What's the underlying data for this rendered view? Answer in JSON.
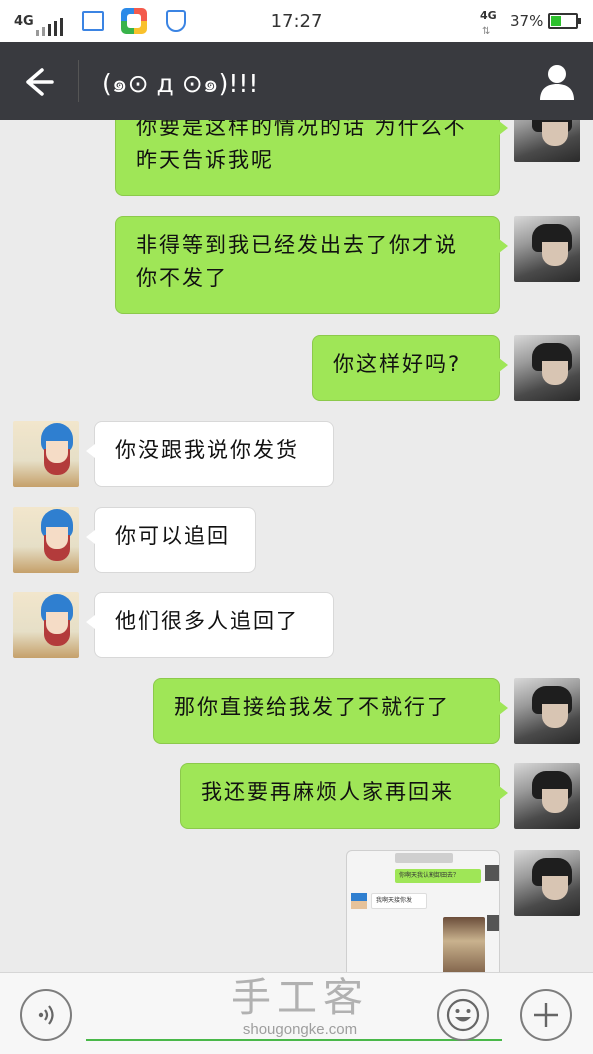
{
  "status_bar": {
    "network_left": "4G",
    "time": "17:27",
    "network_right": "4G",
    "battery_text": "37%",
    "battery_level": 0.37,
    "icons": [
      "signal-icon",
      "gallery-icon",
      "app-store-icon",
      "shield-icon",
      "data-arrows-icon",
      "battery-icon"
    ]
  },
  "header": {
    "title": "(๑⊙ д ⊙๑)!!!",
    "back_icon": "back-arrow-icon",
    "profile_icon": "person-icon"
  },
  "messages": [
    {
      "sender": "me",
      "text": "你要是这样的情况的话 为什么不昨天告诉我呢"
    },
    {
      "sender": "me",
      "text": "非得等到我已经发出去了你才说你不发了"
    },
    {
      "sender": "me",
      "text": "你这样好吗?"
    },
    {
      "sender": "other",
      "text": "你没跟我说你发货"
    },
    {
      "sender": "other",
      "text": "你可以追回"
    },
    {
      "sender": "other",
      "text": "他们很多人追回了"
    },
    {
      "sender": "me",
      "text": "那你直接给我发了不就行了"
    },
    {
      "sender": "me",
      "text": "我还要再麻烦人家再回来"
    },
    {
      "sender": "me",
      "type": "image",
      "thumb": {
        "me_text": "你啊天我认割卸田去？",
        "other_text": "我啊天接你发"
      }
    }
  ],
  "input_bar": {
    "voice_icon": "voice-icon",
    "emoji_icon": "emoji-icon",
    "plus_icon": "plus-icon",
    "input_value": ""
  },
  "watermark": {
    "cn": "手工客",
    "url": "shougongke.com"
  },
  "colors": {
    "title_bar": "#393a3f",
    "bubble_me": "#9fe657",
    "bubble_other": "#ffffff",
    "chat_bg": "#ebebeb",
    "input_underline": "#49b849"
  }
}
